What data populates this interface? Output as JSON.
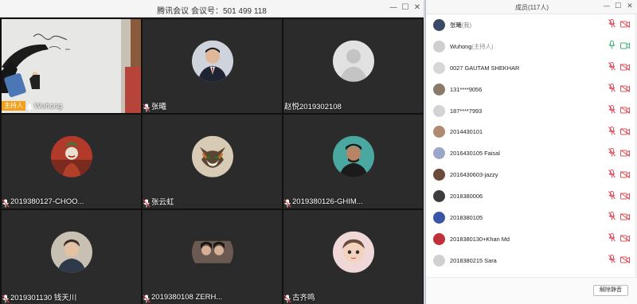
{
  "meeting": {
    "title": "腾讯会议  会议号：501 499 118",
    "window_controls": {
      "minimize": "—",
      "maximize": "☐",
      "close": "✕"
    }
  },
  "tiles": [
    {
      "name": "Wuhong",
      "host_badge": "主持人",
      "type": "video"
    },
    {
      "name": "张曦",
      "type": "avatar",
      "avatar": "photo-man-suit"
    },
    {
      "name": "赵悦2019302108",
      "type": "avatar",
      "avatar": "default-silhouette"
    },
    {
      "name": "2019380127-CHOO...",
      "type": "avatar",
      "avatar": "joker"
    },
    {
      "name": "张云虹",
      "type": "avatar",
      "avatar": "cat"
    },
    {
      "name": "2019380126-GHIM...",
      "type": "avatar",
      "avatar": "young-man"
    },
    {
      "name": "2019301130  钱天川",
      "type": "avatar",
      "avatar": "man-portrait"
    },
    {
      "name": "2019380108 ZERH...",
      "type": "avatar",
      "avatar": "two-women"
    },
    {
      "name": "古齐鸣",
      "type": "avatar",
      "avatar": "child"
    }
  ],
  "members": {
    "title": "成员(117人)",
    "window_controls": {
      "minimize": "—",
      "maximize": "☐",
      "close": "✕"
    },
    "list": [
      {
        "name": "张曦",
        "suffix": "(我)",
        "avatar_color": "#3a4a66",
        "mic": "muted",
        "cam": "off"
      },
      {
        "name": "Wuhong",
        "suffix": "(主持人)",
        "avatar_color": "#cfcfcf",
        "mic": "on",
        "cam": "on"
      },
      {
        "name": "0027 GAUTAM SHEKHAR",
        "suffix": "",
        "avatar_color": "#d6d6d6",
        "mic": "muted",
        "cam": "off"
      },
      {
        "name": "131****9056",
        "suffix": "",
        "avatar_color": "#8a7a6a",
        "mic": "muted",
        "cam": "off"
      },
      {
        "name": "187****7993",
        "suffix": "",
        "avatar_color": "#d3d3d3",
        "mic": "muted",
        "cam": "off"
      },
      {
        "name": "2014430101",
        "suffix": "",
        "avatar_color": "#b08a70",
        "mic": "muted",
        "cam": "off"
      },
      {
        "name": "2016430105 Faisal",
        "suffix": "",
        "avatar_color": "#9aa7c9",
        "mic": "muted",
        "cam": "off"
      },
      {
        "name": "2016430603-jazzy",
        "suffix": "",
        "avatar_color": "#6b4a3a",
        "mic": "muted",
        "cam": "off"
      },
      {
        "name": "2018380006",
        "suffix": "",
        "avatar_color": "#3d3d3d",
        "mic": "muted",
        "cam": "off"
      },
      {
        "name": "2018380105",
        "suffix": "",
        "avatar_color": "#3a55a8",
        "mic": "muted",
        "cam": "off"
      },
      {
        "name": "2018380130+Khan Md",
        "suffix": "",
        "avatar_color": "#c0303a",
        "mic": "muted",
        "cam": "off"
      },
      {
        "name": "2018380215 Sara",
        "suffix": "",
        "avatar_color": "#d0d0d0",
        "mic": "muted",
        "cam": "off"
      }
    ],
    "unmute_all_label": "解除静音"
  },
  "colors": {
    "host_badge": "#f2a01a",
    "muted_red": "#e0505a",
    "active_green": "#3cb371",
    "tile_bg": "#2b2b2b"
  }
}
